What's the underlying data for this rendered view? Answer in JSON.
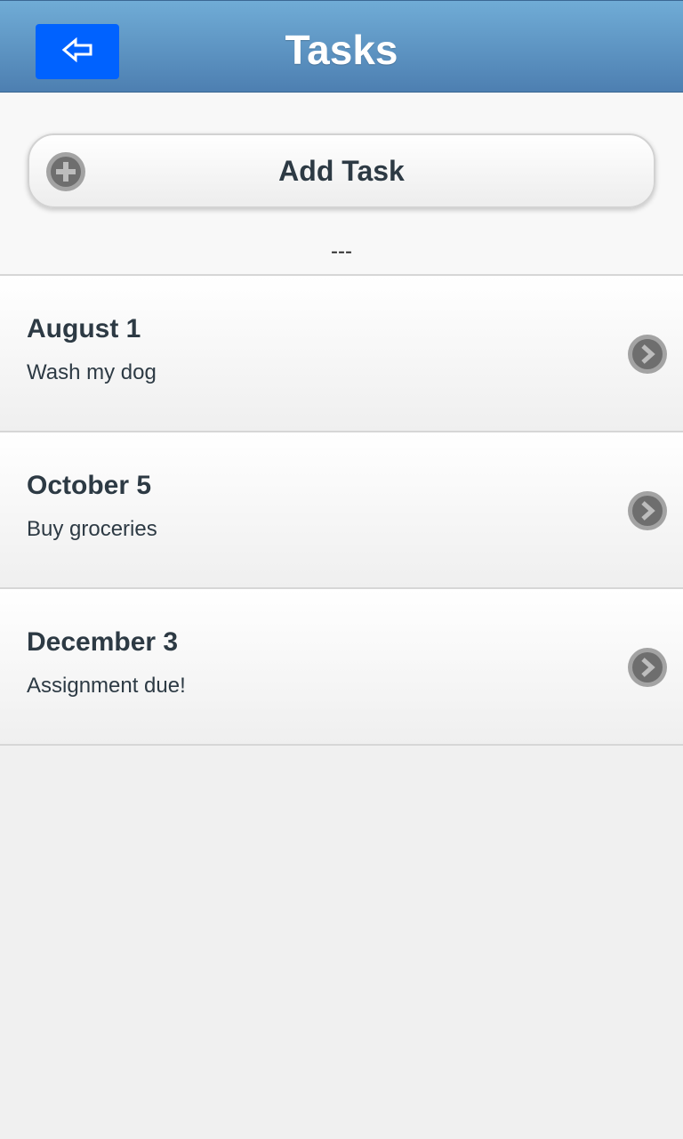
{
  "header": {
    "title": "Tasks",
    "back_icon": "back-arrow-icon"
  },
  "add_task": {
    "label": "Add Task",
    "icon": "plus-circle-icon"
  },
  "divider": "---",
  "tasks": [
    {
      "date": "August 1",
      "description": "Wash my dog"
    },
    {
      "date": "October 5",
      "description": "Buy groceries"
    },
    {
      "date": "December 3",
      "description": "Assignment due!"
    }
  ],
  "colors": {
    "header_gradient_top": "#70acd6",
    "header_gradient_bottom": "#4d7fb1",
    "back_button": "#0062ff",
    "text": "#2d3a44"
  }
}
